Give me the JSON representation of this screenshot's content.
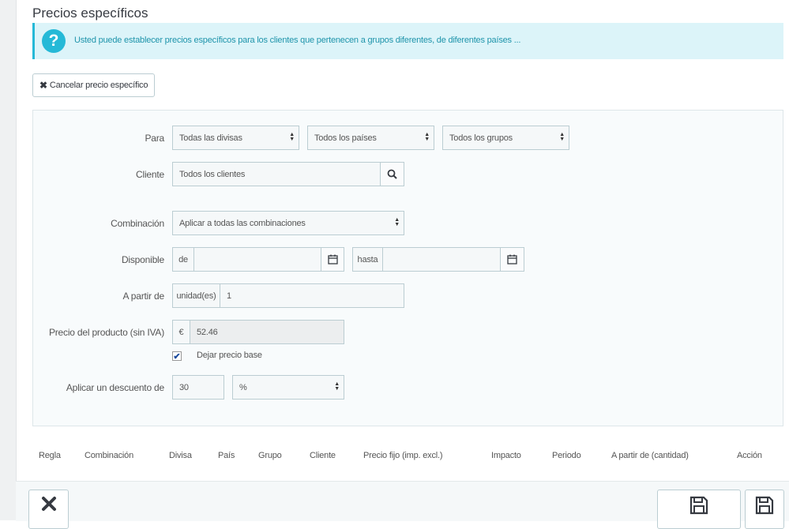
{
  "section": {
    "title": "Precios específicos"
  },
  "alert": {
    "icon": "question-icon",
    "icon_glyph": "?",
    "text": "Usted puede establecer precios específicos para los clientes que pertenecen a grupos diferentes, de diferentes países ..."
  },
  "cancel_button": {
    "icon": "close-icon",
    "label": "Cancelar precio específico"
  },
  "form": {
    "para": {
      "label": "Para",
      "currency_select": "Todas las divisas",
      "country_select": "Todos los países",
      "group_select": "Todos los grupos"
    },
    "cliente": {
      "label": "Cliente",
      "value": "Todos los clientes",
      "icon": "search-icon"
    },
    "combinacion": {
      "label": "Combinación",
      "value": "Aplicar a todas las combinaciones"
    },
    "disponible": {
      "label": "Disponible",
      "from_addon": "de",
      "from_value": "",
      "to_addon": "hasta",
      "to_value": "",
      "icon": "calendar-icon"
    },
    "a_partir_de": {
      "label": "A partir de",
      "addon": "unidad(es)",
      "value": "1"
    },
    "precio": {
      "label": "Precio del producto (sin IVA)",
      "addon": "€",
      "value": "52.46",
      "checkbox_label": "Dejar precio base",
      "checkbox_checked": true
    },
    "descuento": {
      "label": "Aplicar un descuento de",
      "value": "30",
      "type": "%"
    }
  },
  "table": {
    "headers": [
      "Regla",
      "Combinación",
      "Divisa",
      "País",
      "Grupo",
      "Cliente",
      "Precio fijo (imp. excl.)",
      "Impacto",
      "Periodo",
      "A partir de (cantidad)",
      "Acción"
    ]
  },
  "footer": {
    "left_icon": "close-icon",
    "right_icons": [
      "save-icon",
      "save-icon"
    ]
  },
  "colors": {
    "accent": "#25b9d7",
    "alert_bg": "#dcf4f9",
    "border": "#bbcdd2"
  }
}
